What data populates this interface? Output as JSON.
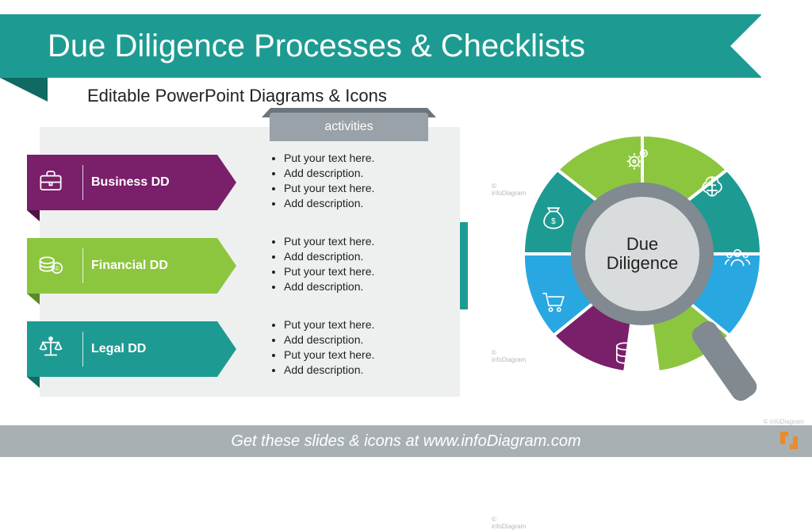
{
  "title": "Due Diligence Processes & Checklists",
  "subtitle": "Editable PowerPoint Diagrams & Icons",
  "column_header": "activities",
  "watermark": "© infoDiagram",
  "rows": [
    {
      "label": "Business DD",
      "color": "purple",
      "bullets": [
        "Put your text here.",
        "Add description.",
        "Put your text here.",
        "Add description."
      ]
    },
    {
      "label": "Financial DD",
      "color": "lime",
      "bullets": [
        "Put your text here.",
        "Add description.",
        "Put your text here.",
        "Add description."
      ]
    },
    {
      "label": "Legal DD",
      "color": "teal",
      "bullets": [
        "Put your text here.",
        "Add description.",
        "Put your text here.",
        "Add description."
      ]
    }
  ],
  "circle": {
    "center_label": "Due\nDiligence",
    "segments": [
      {
        "color": "#8cc63f",
        "icon": "gears-icon"
      },
      {
        "color": "#1d9b92",
        "icon": "brain-icon"
      },
      {
        "color": "#29a7e1",
        "icon": "people-icon"
      },
      {
        "color": "#8cc63f",
        "icon": "puzzle-icon"
      },
      {
        "color": "#7a1f6a",
        "icon": "database-icon"
      },
      {
        "color": "#29a7e1",
        "icon": "cart-icon"
      },
      {
        "color": "#1d9b92",
        "icon": "moneybag-icon"
      }
    ]
  },
  "footer": "Get these slides & icons at www.infoDiagram.com",
  "colors": {
    "teal": "#1d9b92",
    "teal_dark": "#0f6a63",
    "purple": "#7a1f6a",
    "lime": "#8cc63f",
    "blue": "#29a7e1",
    "grey": "#9aa2a9"
  }
}
